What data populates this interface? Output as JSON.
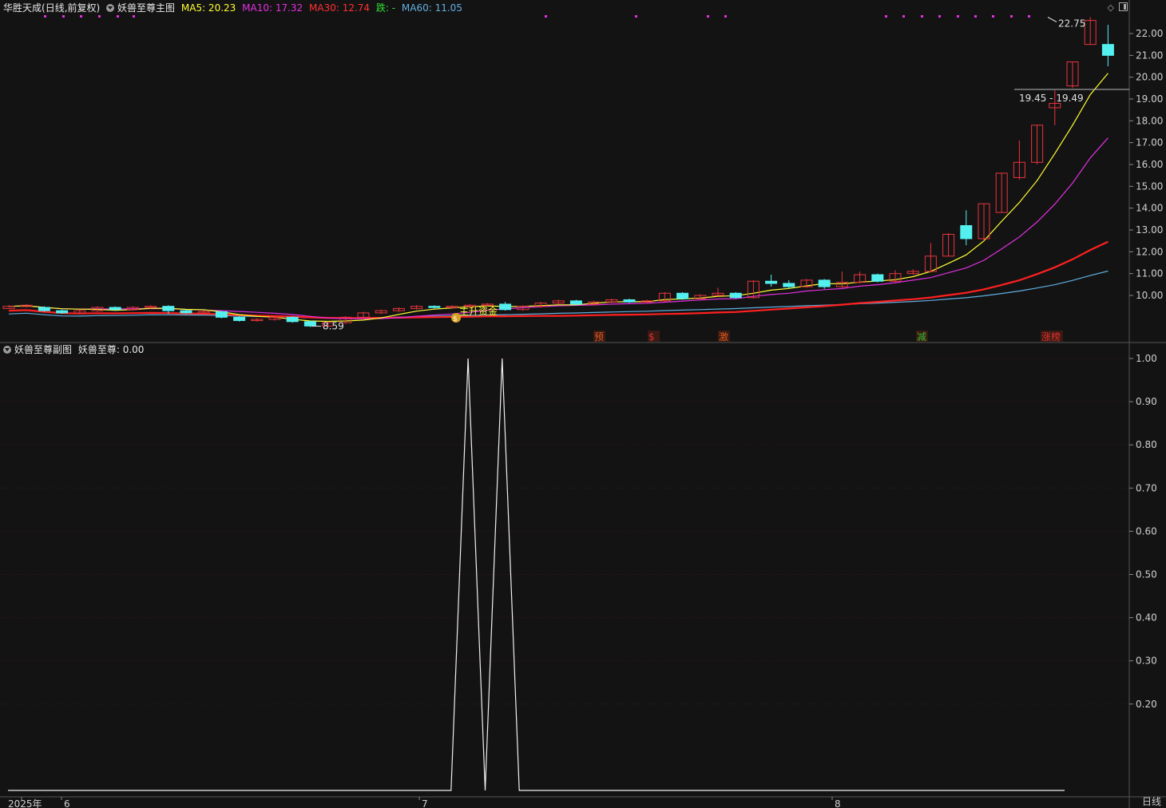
{
  "header": {
    "stock_name": "华胜天成",
    "period": "(日线,前复权)",
    "indicator_main": "妖兽至尊主图",
    "ma5_label": "MA5: 20.23",
    "ma10_label": "MA10: 17.32",
    "ma30_label": "MA30: 12.74",
    "die_label": "跌: -",
    "ma60_label": "MA60: 11.05"
  },
  "sub_header": {
    "indicator_sub": "妖兽至尊副图",
    "value_label": "妖兽至尊: 0.00"
  },
  "colors": {
    "background": "#141314",
    "grid": "#3a1a1a",
    "up": "#e8343b",
    "down": "#54f0f0",
    "ma5": "#ffff33",
    "ma10": "#e030e0",
    "ma30": "#ff2020",
    "ma60": "#60b0e0",
    "ma_mid_green": "#30e030"
  },
  "icons": [
    "diamond-icon",
    "window-icon",
    "dropdown-circle-icon"
  ],
  "corner_label": "日线",
  "chart_data": [
    {
      "type": "candlestick",
      "title": "妖兽至尊主图",
      "y_ticks": [
        22.0,
        21.0,
        20.0,
        19.0,
        18.0,
        17.0,
        16.0,
        15.0,
        14.0,
        13.0,
        12.0,
        11.0,
        10.0
      ],
      "ylim": [
        8.3,
        23.3
      ],
      "x_labels": [
        "2025年",
        "6",
        "7",
        "8"
      ],
      "annotations": [
        {
          "text": "8.59",
          "value": 8.59
        },
        {
          "text": "22.75",
          "value": 22.75
        },
        {
          "text": "19.45 - 19.49",
          "value": 19.49
        },
        {
          "text": "$",
          "kind": "money-badge"
        },
        {
          "text": "主升资金",
          "kind": "tag"
        },
        {
          "text": "预",
          "kind": "signal"
        },
        {
          "text": "$",
          "kind": "signal"
        },
        {
          "text": "激",
          "kind": "signal"
        },
        {
          "text": "减",
          "kind": "signal"
        },
        {
          "text": "涨榜",
          "kind": "signal"
        }
      ],
      "candles": [
        [
          9.4,
          9.5,
          9.45,
          9.55
        ],
        [
          9.5,
          9.55,
          9.45,
          9.6
        ],
        [
          9.45,
          9.3,
          9.25,
          9.5
        ],
        [
          9.3,
          9.2,
          9.15,
          9.35
        ],
        [
          9.2,
          9.3,
          9.15,
          9.35
        ],
        [
          9.3,
          9.45,
          9.25,
          9.5
        ],
        [
          9.45,
          9.35,
          9.3,
          9.5
        ],
        [
          9.35,
          9.45,
          9.3,
          9.5
        ],
        [
          9.45,
          9.5,
          9.4,
          9.55
        ],
        [
          9.5,
          9.3,
          9.15,
          9.55
        ],
        [
          9.3,
          9.2,
          9.15,
          9.35
        ],
        [
          9.2,
          9.25,
          9.1,
          9.3
        ],
        [
          9.25,
          9.0,
          8.95,
          9.3
        ],
        [
          9.0,
          8.85,
          8.8,
          9.05
        ],
        [
          8.85,
          8.9,
          8.8,
          8.95
        ],
        [
          8.9,
          9.0,
          8.85,
          9.05
        ],
        [
          9.0,
          8.8,
          8.75,
          9.05
        ],
        [
          8.8,
          8.6,
          8.55,
          8.85
        ],
        [
          8.6,
          8.75,
          8.59,
          8.8
        ],
        [
          8.75,
          9.0,
          8.7,
          9.05
        ],
        [
          9.0,
          9.2,
          8.95,
          9.25
        ],
        [
          9.2,
          9.3,
          9.15,
          9.35
        ],
        [
          9.3,
          9.4,
          9.25,
          9.45
        ],
        [
          9.4,
          9.5,
          9.35,
          9.55
        ],
        [
          9.5,
          9.45,
          9.4,
          9.55
        ],
        [
          9.45,
          9.5,
          9.4,
          9.55
        ],
        [
          9.5,
          9.55,
          9.45,
          9.6
        ],
        [
          9.55,
          9.6,
          9.5,
          9.65
        ],
        [
          9.6,
          9.35,
          9.3,
          9.7
        ],
        [
          9.35,
          9.5,
          9.3,
          9.55
        ],
        [
          9.5,
          9.65,
          9.45,
          9.7
        ],
        [
          9.65,
          9.75,
          9.6,
          9.8
        ],
        [
          9.75,
          9.6,
          9.55,
          9.8
        ],
        [
          9.6,
          9.7,
          9.55,
          9.75
        ],
        [
          9.7,
          9.8,
          9.65,
          9.85
        ],
        [
          9.8,
          9.7,
          9.65,
          9.85
        ],
        [
          9.7,
          9.75,
          9.65,
          9.8
        ],
        [
          9.75,
          10.1,
          9.7,
          10.15
        ],
        [
          10.1,
          9.85,
          9.8,
          10.15
        ],
        [
          9.85,
          10.0,
          9.8,
          10.05
        ],
        [
          10.0,
          10.1,
          9.95,
          10.35
        ],
        [
          10.1,
          9.9,
          9.85,
          10.15
        ],
        [
          9.9,
          10.65,
          9.85,
          10.7
        ],
        [
          10.65,
          10.55,
          10.4,
          10.95
        ],
        [
          10.55,
          10.4,
          10.3,
          10.7
        ],
        [
          10.4,
          10.7,
          10.35,
          10.75
        ],
        [
          10.7,
          10.4,
          10.3,
          10.75
        ],
        [
          10.4,
          10.6,
          10.35,
          11.1
        ],
        [
          10.6,
          10.95,
          10.55,
          11.1
        ],
        [
          10.95,
          10.65,
          10.6,
          11.0
        ],
        [
          10.65,
          11.0,
          10.6,
          11.15
        ],
        [
          11.0,
          11.1,
          10.95,
          11.2
        ],
        [
          11.1,
          11.8,
          11.05,
          12.4
        ],
        [
          11.8,
          12.8,
          11.8,
          12.85
        ],
        [
          13.2,
          12.6,
          12.3,
          13.9
        ],
        [
          12.6,
          14.2,
          12.5,
          14.2
        ],
        [
          13.8,
          15.6,
          13.8,
          15.6
        ],
        [
          15.4,
          16.1,
          15.3,
          17.1
        ],
        [
          16.1,
          17.8,
          16.0,
          17.8
        ],
        [
          18.6,
          18.8,
          17.8,
          19.4
        ],
        [
          19.6,
          20.7,
          19.5,
          20.7
        ],
        [
          21.5,
          22.6,
          21.5,
          22.75
        ],
        [
          21.5,
          21.0,
          20.5,
          22.4
        ]
      ]
    },
    {
      "type": "line",
      "title": "妖兽至尊副图",
      "series_name": "妖兽至尊",
      "y_ticks": [
        1.0,
        0.9,
        0.8,
        0.7,
        0.6,
        0.5,
        0.4,
        0.3,
        0.2
      ],
      "ylim": [
        0,
        1.0
      ],
      "values": [
        0,
        0,
        0,
        0,
        0,
        0,
        0,
        0,
        0,
        0,
        0,
        0,
        0,
        0,
        0,
        0,
        0,
        0,
        0,
        0,
        0,
        0,
        0,
        0,
        0,
        0,
        0,
        1,
        0,
        1,
        0,
        0,
        0,
        0,
        0,
        0,
        0,
        0,
        0,
        0,
        0,
        0,
        0,
        0,
        0,
        0,
        0,
        0,
        0,
        0,
        0,
        0,
        0,
        0,
        0,
        0,
        0,
        0,
        0,
        0,
        0,
        0,
        0
      ]
    }
  ]
}
